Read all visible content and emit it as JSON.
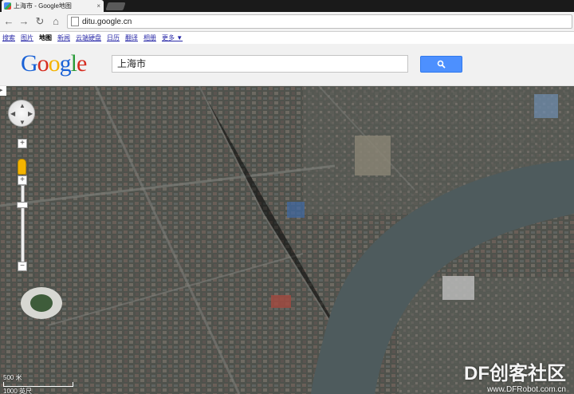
{
  "browser": {
    "tab_title": "上海市 - Google地图",
    "tab_close": "×",
    "url": "ditu.google.cn"
  },
  "gbar": {
    "items": [
      "搜索",
      "图片",
      "地图",
      "新闻",
      "云端硬盘",
      "日历",
      "翻译",
      "相册",
      "更多 ▼"
    ],
    "active_index": 2
  },
  "header": {
    "logo_letters": [
      "G",
      "o",
      "o",
      "g",
      "l",
      "e"
    ],
    "logo_colors": [
      "#1a62d6",
      "#d62d20",
      "#f4b400",
      "#1a62d6",
      "#2b9b3a",
      "#d62d20"
    ],
    "search_value": "上海市",
    "search_button_color": "#4d90fe"
  },
  "map": {
    "zoom_in": "+",
    "zoom_out": "−",
    "scale_top": "500 米",
    "scale_bottom": "1000 英尺",
    "water_color": "#4d5a5c",
    "land_color": "#53574f"
  },
  "watermark": {
    "line1": "DF创客社区",
    "line2": "www.DFRobot.com.cn"
  }
}
